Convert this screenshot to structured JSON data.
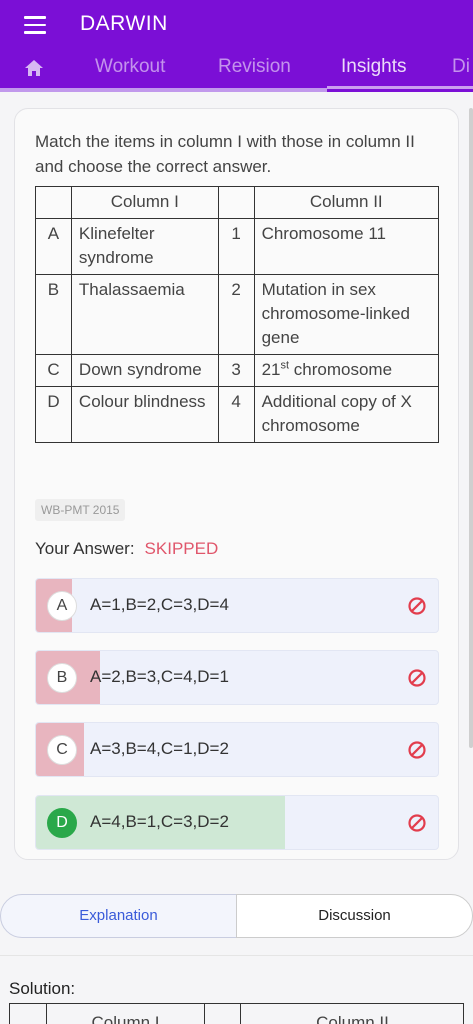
{
  "app": {
    "title": "DARWIN"
  },
  "tabs": [
    {
      "label": "Workout"
    },
    {
      "label": "Revision"
    },
    {
      "label": "Insights"
    },
    {
      "label": "Di"
    }
  ],
  "question": {
    "text": "Match the items in column I with those in column II and choose the correct answer.",
    "table": {
      "headers": [
        "",
        "Column I",
        "",
        "Column II"
      ],
      "rows": [
        {
          "key": "A",
          "col1": "Klinefelter syndrome",
          "num": "1",
          "col2": "Chromosome 11"
        },
        {
          "key": "B",
          "col1": "Thalassaemia",
          "num": "2",
          "col2": "Mutation in sex chromosome-linked gene"
        },
        {
          "key": "C",
          "col1": "Down syndrome",
          "num": "3",
          "col2_pre": "21",
          "col2_sup": "st",
          "col2_post": " chromosome"
        },
        {
          "key": "D",
          "col1": "Colour blindness",
          "num": "4",
          "col2": "Additional copy of X chromosome"
        }
      ]
    },
    "source": "WB-PMT 2015"
  },
  "answer": {
    "label": "Your Answer:",
    "value": "SKIPPED"
  },
  "options": [
    {
      "letter": "A",
      "text": "A=1,B=2,C=3,D=4",
      "fill_percent": 9,
      "correct": false
    },
    {
      "letter": "B",
      "text": "A=2,B=3,C=4,D=1",
      "fill_percent": 16,
      "correct": false
    },
    {
      "letter": "C",
      "text": "A=3,B=4,C=1,D=2",
      "fill_percent": 12,
      "correct": false
    },
    {
      "letter": "D",
      "text": "A=4,B=1,C=3,D=2",
      "fill_percent": 62,
      "correct": true
    }
  ],
  "bottom_tabs": {
    "explanation": "Explanation",
    "discussion": "Discussion"
  },
  "solution": {
    "label": "Solution:",
    "headers": [
      "",
      "Column I",
      "",
      "Column II"
    ]
  },
  "colors": {
    "brand": "#7b0fd6",
    "wrong_fill": "#e8b5bf",
    "correct_fill": "#cfe8d5",
    "skipped": "#e0566b",
    "ban": "#e23d4d"
  }
}
